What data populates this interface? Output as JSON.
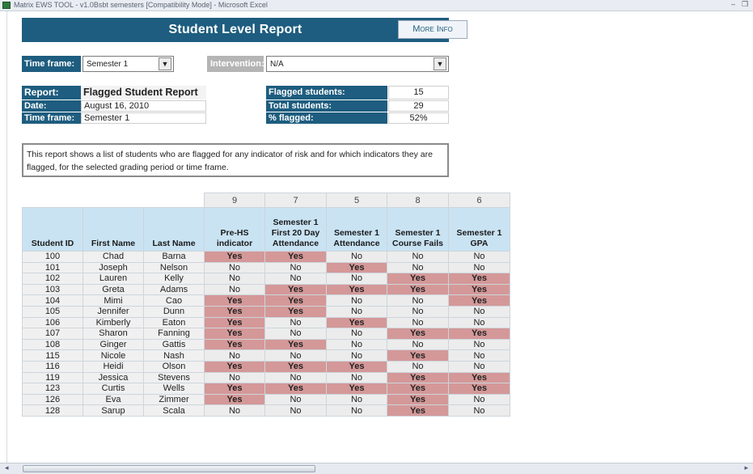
{
  "window": {
    "title": "Matrix EWS TOOL - v1.0Bsbt semesters [Compatibility Mode] - Microsoft Excel",
    "minimize": "–",
    "restore": "❐"
  },
  "banner": {
    "title": "Student Level Report",
    "more_info": "More Info",
    "color": "#1e5d7f"
  },
  "filters": {
    "timeframe_label": "Time frame:",
    "timeframe_value": "Semester 1",
    "intervention_label": "Intervention:",
    "intervention_value": "N/A"
  },
  "report_info": {
    "report_label": "Report:",
    "report_value": "Flagged Student Report",
    "date_label": "Date:",
    "date_value": "August 16, 2010",
    "timeframe_label": "Time frame:",
    "timeframe_value": "Semester 1",
    "flagged_label": "Flagged students:",
    "flagged_value": "15",
    "total_label": "Total students:",
    "total_value": "29",
    "pct_label": "% flagged:",
    "pct_value": "52%"
  },
  "description": "This report shows a list of students who are flagged for any indicator of risk and for which indicators they are flagged, for the selected grading period or time frame.",
  "table": {
    "counts": [
      "9",
      "7",
      "5",
      "8",
      "6"
    ],
    "headers": [
      "Student ID",
      "First Name",
      "Last Name",
      "Pre-HS indicator",
      "Semester 1 First 20 Day Attendance",
      "Semester 1 Attendance",
      "Semester 1 Course Fails",
      "Semester 1 GPA"
    ],
    "rows": [
      [
        "100",
        "Chad",
        "Barna",
        "Yes",
        "Yes",
        "No",
        "No",
        "No"
      ],
      [
        "101",
        "Joseph",
        "Nelson",
        "No",
        "No",
        "Yes",
        "No",
        "No"
      ],
      [
        "102",
        "Lauren",
        "Kelly",
        "No",
        "No",
        "No",
        "Yes",
        "Yes"
      ],
      [
        "103",
        "Greta",
        "Adams",
        "No",
        "Yes",
        "Yes",
        "Yes",
        "Yes"
      ],
      [
        "104",
        "Mimi",
        "Cao",
        "Yes",
        "Yes",
        "No",
        "No",
        "Yes"
      ],
      [
        "105",
        "Jennifer",
        "Dunn",
        "Yes",
        "Yes",
        "No",
        "No",
        "No"
      ],
      [
        "106",
        "Kimberly",
        "Eaton",
        "Yes",
        "No",
        "Yes",
        "No",
        "No"
      ],
      [
        "107",
        "Sharon",
        "Fanning",
        "Yes",
        "No",
        "No",
        "Yes",
        "Yes"
      ],
      [
        "108",
        "Ginger",
        "Gattis",
        "Yes",
        "Yes",
        "No",
        "No",
        "No"
      ],
      [
        "115",
        "Nicole",
        "Nash",
        "No",
        "No",
        "No",
        "Yes",
        "No"
      ],
      [
        "116",
        "Heidi",
        "Olson",
        "Yes",
        "Yes",
        "Yes",
        "No",
        "No"
      ],
      [
        "119",
        "Jessica",
        "Stevens",
        "No",
        "No",
        "No",
        "Yes",
        "Yes"
      ],
      [
        "123",
        "Curtis",
        "Wells",
        "Yes",
        "Yes",
        "Yes",
        "Yes",
        "Yes"
      ],
      [
        "126",
        "Eva",
        "Zimmer",
        "Yes",
        "No",
        "No",
        "Yes",
        "No"
      ],
      [
        "128",
        "Sarup",
        "Scala",
        "No",
        "No",
        "No",
        "Yes",
        "No"
      ]
    ],
    "flag_color": "#d49898"
  },
  "scrollbar": {
    "left_arrow": "◂",
    "right_arrow": "▸"
  }
}
